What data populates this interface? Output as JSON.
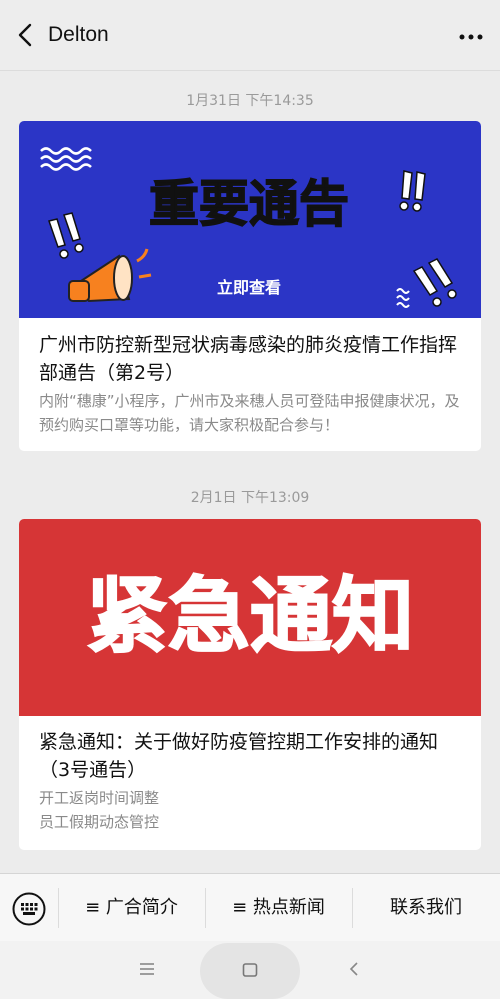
{
  "header": {
    "title": "Delton"
  },
  "messages": [
    {
      "time": "1月31日 下午14:35",
      "banner_text": "重要通告",
      "banner_button": "立即查看",
      "title": "广州市防控新型冠状病毒感染的肺炎疫情工作指挥部通告（第2号）",
      "description": "内附“穗康”小程序，广州市及来穗人员可登陆申报健康状况，及预约购买口罩等功能，请大家积极配合参与！",
      "banner_color": "#2b35c6"
    },
    {
      "time": "2月1日 下午13:09",
      "banner_text": "紧急通知",
      "title": "紧急通知：关于做好防疫管控期工作安排的通知（3号通告）",
      "description_lines": [
        "开工返岗时间调整",
        "员工假期动态管控"
      ],
      "banner_color": "#d63536"
    }
  ],
  "menu": {
    "items": [
      {
        "label": "≡ 广合简介"
      },
      {
        "label": "≡ 热点新闻"
      },
      {
        "label": "联系我们"
      }
    ]
  }
}
